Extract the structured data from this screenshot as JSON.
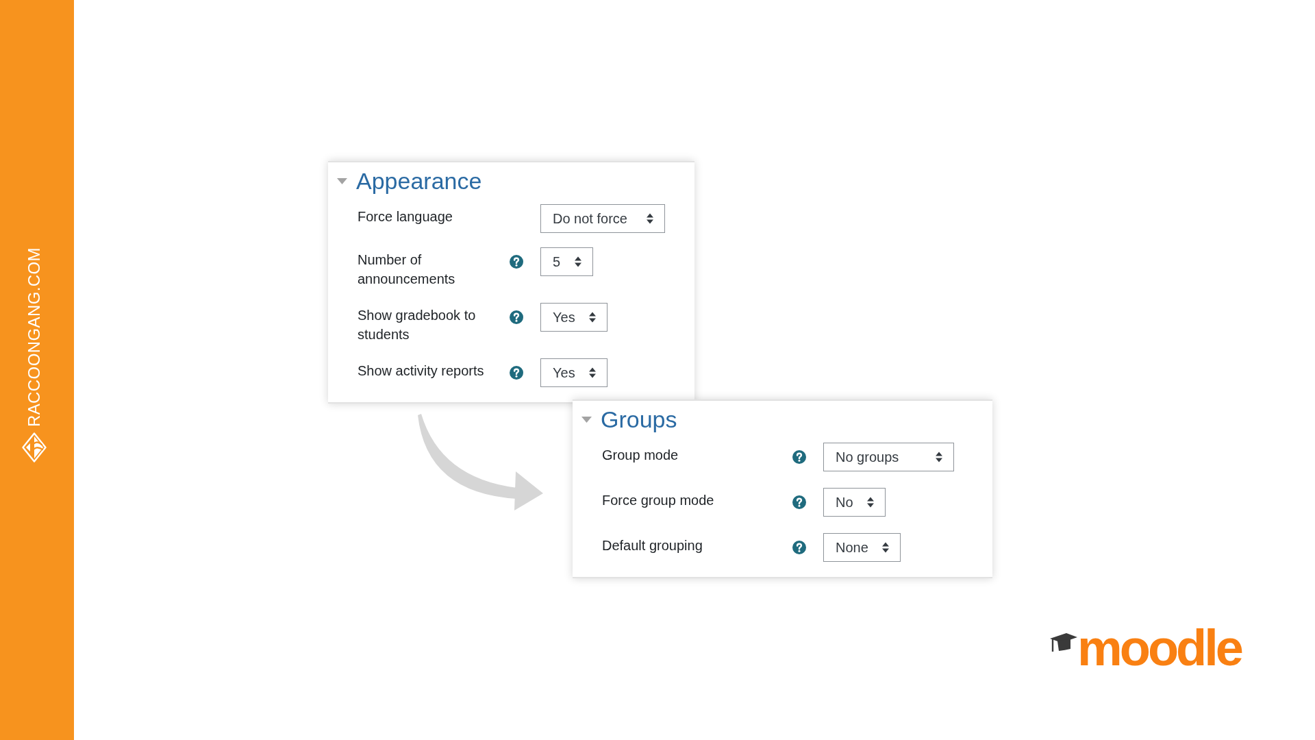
{
  "sidebar": {
    "brand": "RACCOONGANG.COM"
  },
  "panels": [
    {
      "title": "Appearance",
      "expanded": true,
      "fields": [
        {
          "label": "Force language",
          "help": false,
          "value": "Do not force"
        },
        {
          "label": "Number of announcements",
          "help": true,
          "value": "5"
        },
        {
          "label": "Show gradebook to students",
          "help": true,
          "value": "Yes"
        },
        {
          "label": "Show activity reports",
          "help": true,
          "value": "Yes"
        }
      ]
    },
    {
      "title": "Groups",
      "expanded": true,
      "fields": [
        {
          "label": "Group mode",
          "help": true,
          "value": "No groups"
        },
        {
          "label": "Force group mode",
          "help": true,
          "value": "No"
        },
        {
          "label": "Default grouping",
          "help": true,
          "value": "None"
        }
      ]
    }
  ],
  "logo": {
    "text": "moodle"
  }
}
